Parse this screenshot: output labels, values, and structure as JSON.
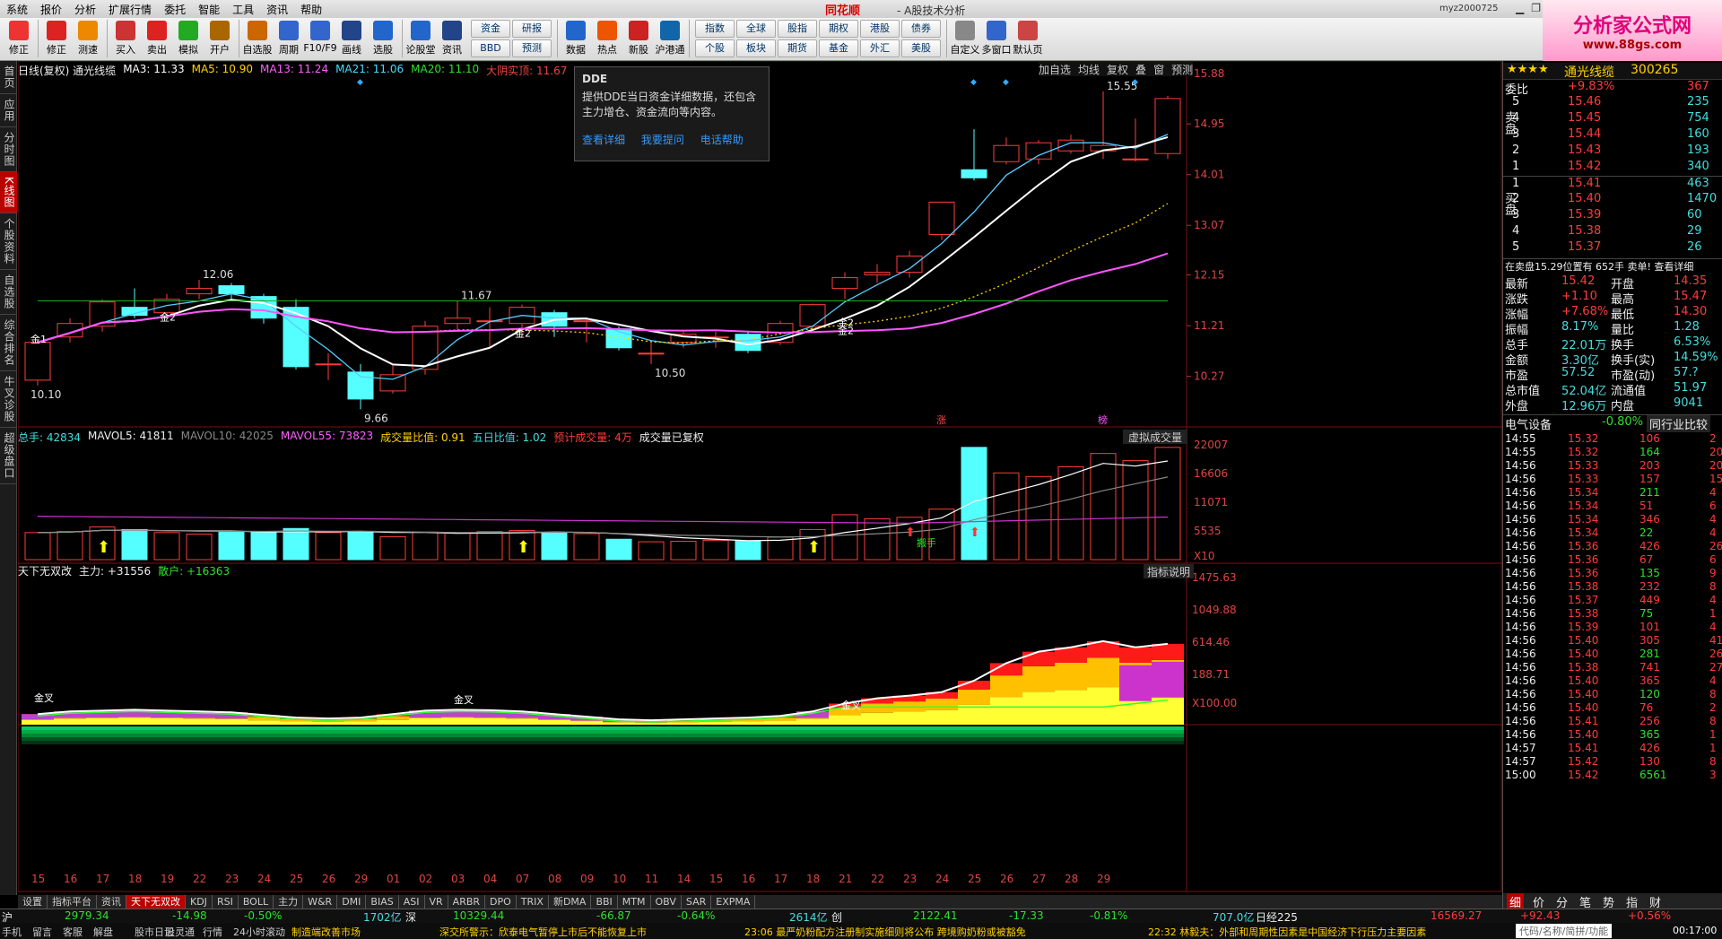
{
  "menu": {
    "items": [
      "系统",
      "报价",
      "分析",
      "扩展行情",
      "委托",
      "智能",
      "工具",
      "资讯",
      "帮助"
    ],
    "brand": "同花顺",
    "title": "- A股技术分析",
    "user": "myz2000725"
  },
  "toolbar": {
    "buttons": [
      "修正",
      "测速",
      "买入",
      "卖出",
      "模拟",
      "开户",
      "自选股",
      "周期",
      "F10/F9",
      "画线",
      "选股",
      "论股堂",
      "资讯"
    ],
    "grid1": [
      "资金",
      "研报",
      "BBD",
      "预测"
    ],
    "mid": [
      "数据",
      "热点",
      "新股",
      "沪港通"
    ],
    "grid2": [
      "指数",
      "全球",
      "股指",
      "期权",
      "港股",
      "债券",
      "个股",
      "板块",
      "期货",
      "基金",
      "外汇",
      "美股"
    ],
    "right": [
      "自定义",
      "多窗口",
      "默认页"
    ]
  },
  "logo": {
    "big": "分析家公式网",
    "small": "www.88gs.com"
  },
  "lefttabs": [
    "首页",
    "应用",
    "分时图",
    "K线图",
    "个股资料",
    "自选股",
    "综合排名",
    "牛叉诊股",
    "超级盘口"
  ],
  "header": {
    "title": "日线(复权) 通光线缆",
    "ma3": "MA3: 11.33",
    "ma5": "MA5: 10.90",
    "ma13": "MA13: 11.24",
    "ma21": "MA21: 11.06",
    "ma20": "MA20: 11.10",
    "dyst": "大阴实顶: 11.67",
    "right_tools": [
      "加自选",
      "均线",
      "复权",
      "叠",
      "窗",
      "预测"
    ]
  },
  "tooltip": {
    "title": "DDE",
    "body1": "提供DDE当日资金详细数据，还包含",
    "body2": "主力增仓、资金流向等内容。",
    "links": [
      "查看详细",
      "我要提问",
      "电话帮助"
    ]
  },
  "price_axis": [
    "15.88",
    "14.95",
    "14.01",
    "13.07",
    "12.15",
    "11.21",
    "10.27"
  ],
  "candles": [
    {
      "o": 10.2,
      "c": 10.9,
      "h": 10.95,
      "l": 10.1
    },
    {
      "o": 11.0,
      "c": 11.25,
      "h": 11.35,
      "l": 10.9
    },
    {
      "o": 11.2,
      "c": 11.65,
      "h": 11.7,
      "l": 11.1
    },
    {
      "o": 11.55,
      "c": 11.4,
      "h": 11.9,
      "l": 11.35
    },
    {
      "o": 11.45,
      "c": 11.7,
      "h": 11.8,
      "l": 11.4
    },
    {
      "o": 11.8,
      "c": 11.9,
      "h": 12.06,
      "l": 11.7
    },
    {
      "o": 11.95,
      "c": 11.8,
      "h": 12.0,
      "l": 11.7
    },
    {
      "o": 11.75,
      "c": 11.35,
      "h": 11.8,
      "l": 11.25
    },
    {
      "o": 11.55,
      "c": 10.45,
      "h": 11.7,
      "l": 10.4
    },
    {
      "o": 10.5,
      "c": 10.5,
      "h": 10.7,
      "l": 10.2
    },
    {
      "o": 10.35,
      "c": 9.85,
      "h": 10.5,
      "l": 9.66
    },
    {
      "o": 10.0,
      "c": 10.3,
      "h": 10.5,
      "l": 9.95
    },
    {
      "o": 10.4,
      "c": 11.2,
      "h": 11.3,
      "l": 10.3
    },
    {
      "o": 11.25,
      "c": 11.35,
      "h": 11.67,
      "l": 11.1
    },
    {
      "o": 11.3,
      "c": 11.3,
      "h": 11.55,
      "l": 10.8
    },
    {
      "o": 11.25,
      "c": 11.55,
      "h": 11.6,
      "l": 11.0
    },
    {
      "o": 11.45,
      "c": 11.2,
      "h": 11.5,
      "l": 11.0
    },
    {
      "o": 11.3,
      "c": 11.3,
      "h": 11.35,
      "l": 10.9
    },
    {
      "o": 11.15,
      "c": 10.8,
      "h": 11.2,
      "l": 10.75
    },
    {
      "o": 10.7,
      "c": 10.7,
      "h": 10.9,
      "l": 10.5
    },
    {
      "o": 10.9,
      "c": 11.05,
      "h": 11.1,
      "l": 10.8
    },
    {
      "o": 11.0,
      "c": 11.0,
      "h": 11.1,
      "l": 10.8
    },
    {
      "o": 11.05,
      "c": 10.75,
      "h": 11.1,
      "l": 10.7
    },
    {
      "o": 10.9,
      "c": 11.25,
      "h": 11.3,
      "l": 10.85
    },
    {
      "o": 11.2,
      "c": 11.6,
      "h": 11.62,
      "l": 11.15
    },
    {
      "o": 11.9,
      "c": 12.1,
      "h": 12.2,
      "l": 11.7
    },
    {
      "o": 12.15,
      "c": 12.2,
      "h": 12.35,
      "l": 12.0
    },
    {
      "o": 12.2,
      "c": 12.5,
      "h": 12.6,
      "l": 12.1
    },
    {
      "o": 12.9,
      "c": 13.5,
      "h": 13.5,
      "l": 12.8
    },
    {
      "o": 14.1,
      "c": 13.95,
      "h": 14.85,
      "l": 13.9
    },
    {
      "o": 14.25,
      "c": 14.55,
      "h": 14.7,
      "l": 14.2
    },
    {
      "o": 14.3,
      "c": 14.6,
      "h": 14.65,
      "l": 14.2
    },
    {
      "o": 14.45,
      "c": 14.65,
      "h": 14.75,
      "l": 14.4
    },
    {
      "o": 14.45,
      "c": 14.55,
      "h": 15.55,
      "l": 14.3
    },
    {
      "o": 14.3,
      "c": 14.3,
      "h": 15.05,
      "l": 14.25
    },
    {
      "o": 14.4,
      "c": 15.42,
      "h": 15.47,
      "l": 14.3
    }
  ],
  "price_marks": [
    "12.06",
    "11.67",
    "10.10",
    "9.66",
    "10.50",
    "15.55"
  ],
  "signals": [
    "金1",
    "金2",
    "金2",
    "金2",
    "金2"
  ],
  "labels_top": [
    "涨",
    "榜"
  ],
  "vol_header": {
    "total": "总手: 42834",
    "mavol5": "MAVOL5: 41811",
    "mavol10": "MAVOL10: 42025",
    "mavol55": "MAVOL55: 73823",
    "ratio": "成交量比值: 0.91",
    "five": "五日比值: 1.02",
    "est": "预计成交量: 4万",
    "reset": "成交量已复权",
    "vbtn": "虚拟成交量"
  },
  "vol_axis": [
    "22007",
    "16606",
    "11071",
    "5535",
    "X10"
  ],
  "volumes": [
    5.3,
    5.5,
    6.4,
    5.9,
    5.3,
    5.0,
    5.5,
    5.4,
    6.1,
    5.3,
    5.4,
    4.5,
    5.4,
    5.2,
    5.5,
    5.7,
    5.2,
    5.1,
    4.0,
    3.5,
    3.6,
    3.8,
    3.7,
    4.4,
    5.9,
    8.8,
    8.0,
    8.3,
    9.9,
    22.0,
    17.0,
    16.3,
    18.2,
    20.8,
    19.4,
    22.0
  ],
  "vol_tag": "搬手",
  "ind_header": {
    "name": "天下无双改",
    "zl": "主力: +31556",
    "sh": "散户: +16363",
    "btn": "指标说明"
  },
  "ind_axis": [
    "1475.63",
    "1049.88",
    "614.46",
    "188.71",
    "X100.00"
  ],
  "ind_values": [
    120,
    150,
    160,
    170,
    160,
    150,
    140,
    110,
    80,
    70,
    80,
    120,
    160,
    170,
    165,
    150,
    120,
    90,
    60,
    50,
    60,
    70,
    80,
    100,
    150,
    240,
    300,
    330,
    370,
    500,
    700,
    830,
    880,
    950,
    880,
    920
  ],
  "ind_labels": [
    "金叉",
    "金叉",
    "金叉"
  ],
  "dates": [
    "15",
    "16",
    "17",
    "18",
    "19",
    "22",
    "23",
    "24",
    "25",
    "26",
    "29",
    "01",
    "02",
    "03",
    "04",
    "07",
    "08",
    "09",
    "10",
    "11",
    "14",
    "15",
    "16",
    "17",
    "18",
    "21",
    "22",
    "23",
    "24",
    "25",
    "26",
    "27",
    "28",
    "29"
  ],
  "bottom_tabs": [
    "设置",
    "指标平台",
    "资讯",
    "天下无双改",
    "KDJ",
    "RSI",
    "BOLL",
    "主力",
    "W&R",
    "DMI",
    "BIAS",
    "ASI",
    "VR",
    "ARBR",
    "DPO",
    "TRIX",
    "新DMA",
    "BBI",
    "MTM",
    "OBV",
    "SAR",
    "EXPMA"
  ],
  "quote": {
    "name": "通光线缆",
    "code": "300265",
    "weibi_l": "委比",
    "weibi": "+9.83%",
    "weibi_n": "367",
    "sell": [
      {
        "n": "5",
        "p": "15.46",
        "v": "235"
      },
      {
        "n": "4",
        "p": "15.45",
        "v": "754"
      },
      {
        "n": "3",
        "p": "15.44",
        "v": "160"
      },
      {
        "n": "2",
        "p": "15.43",
        "v": "193"
      },
      {
        "n": "1",
        "p": "15.42",
        "v": "340"
      }
    ],
    "buy": [
      {
        "n": "1",
        "p": "15.41",
        "v": "463"
      },
      {
        "n": "2",
        "p": "15.40",
        "v": "1470"
      },
      {
        "n": "3",
        "p": "15.39",
        "v": "60"
      },
      {
        "n": "4",
        "p": "15.38",
        "v": "29"
      },
      {
        "n": "5",
        "p": "15.37",
        "v": "26"
      }
    ],
    "sellside": "卖盘",
    "buyside": "买盘",
    "note": "在卖盘15.29位置有 652手 卖单! 查看详细",
    "stats": [
      [
        "最新",
        "15.42",
        "开盘",
        "14.35"
      ],
      [
        "涨跌",
        "+1.10",
        "最高",
        "15.47"
      ],
      [
        "涨幅",
        "+7.68%",
        "最低",
        "14.30"
      ],
      [
        "振幅",
        "8.17%",
        "量比",
        "1.28"
      ],
      [
        "总手",
        "22.01万",
        "换手",
        "6.53%"
      ],
      [
        "金额",
        "3.30亿",
        "换手(实)",
        "14.59%"
      ],
      [
        "市盈",
        "57.52",
        "市盈(动)",
        "57.?"
      ],
      [
        "总市值",
        "52.04亿",
        "流通值",
        "51.97"
      ],
      [
        "外盘",
        "12.96万",
        "内盘",
        "9041"
      ]
    ],
    "sector": "电气设备",
    "sector_chg": "-0.80%",
    "sector_btn": "同行业比较",
    "ticks": [
      [
        "14:55",
        "15.32",
        "106",
        "2"
      ],
      [
        "14:55",
        "15.32",
        "164",
        "20"
      ],
      [
        "14:56",
        "15.33",
        "203",
        "20"
      ],
      [
        "14:56",
        "15.33",
        "157",
        "15"
      ],
      [
        "14:56",
        "15.34",
        "211",
        "4"
      ],
      [
        "14:56",
        "15.34",
        "51",
        "6"
      ],
      [
        "14:56",
        "15.34",
        "346",
        "4"
      ],
      [
        "14:56",
        "15.34",
        "22",
        "4"
      ],
      [
        "14:56",
        "15.36",
        "426",
        "26"
      ],
      [
        "14:56",
        "15.36",
        "67",
        "6"
      ],
      [
        "14:56",
        "15.36",
        "135",
        "9"
      ],
      [
        "14:56",
        "15.38",
        "232",
        "8"
      ],
      [
        "14:56",
        "15.37",
        "449",
        "4"
      ],
      [
        "14:56",
        "15.38",
        "75",
        "1"
      ],
      [
        "14:56",
        "15.39",
        "101",
        "4"
      ],
      [
        "14:56",
        "15.40",
        "305",
        "41"
      ],
      [
        "14:56",
        "15.40",
        "281",
        "26"
      ],
      [
        "14:56",
        "15.38",
        "741",
        "27"
      ],
      [
        "14:56",
        "15.40",
        "365",
        "4"
      ],
      [
        "14:56",
        "15.40",
        "120",
        "8"
      ],
      [
        "14:56",
        "15.40",
        "76",
        "2"
      ],
      [
        "14:56",
        "15.41",
        "256",
        "8"
      ],
      [
        "14:56",
        "15.40",
        "365",
        "1"
      ],
      [
        "14:57",
        "15.41",
        "426",
        "1"
      ],
      [
        "14:57",
        "15.42",
        "130",
        "8"
      ],
      [
        "15:00",
        "15.42",
        "6561",
        "3"
      ]
    ],
    "tabs": [
      "细",
      "价",
      "分",
      "笔",
      "势",
      "指",
      "财"
    ]
  },
  "status": {
    "sh": "沪",
    "sh_v": "2979.34",
    "sh_c": "-14.98",
    "sh_p": "-0.50%",
    "sh_amt": "1702亿",
    "sz": "深",
    "sz_v": "10329.44",
    "sz_c": "-66.87",
    "sz_p": "-0.64%",
    "sz_amt": "2614亿",
    "cy": "创",
    "cy_v": "2122.41",
    "cy_c": "-17.33",
    "cy_p": "-0.81%",
    "cy_amt": "707.0亿",
    "nk": "日经225",
    "nk_v": "16569.27",
    "nk_c": "+92.43",
    "nk_p": "+0.56%"
  },
  "status2": {
    "items": [
      "手机",
      "留言",
      "客服",
      "解盘",
      "股市日记",
      "股灵通",
      "行情",
      "24小时滚动"
    ],
    "news1": "制造端改善市场",
    "news2": "深交所警示：欣泰电气暂停上市后不能恢复上市",
    "news3": "23:06 最严奶粉配方注册制实施细则将公布 跨境购奶粉或被豁免",
    "news4": "22:32 林毅夫：外部和周期性因素是中国经济下行压力主要因素",
    "search": "代码/名称/简拼/功能",
    "time": "00:17:00"
  }
}
